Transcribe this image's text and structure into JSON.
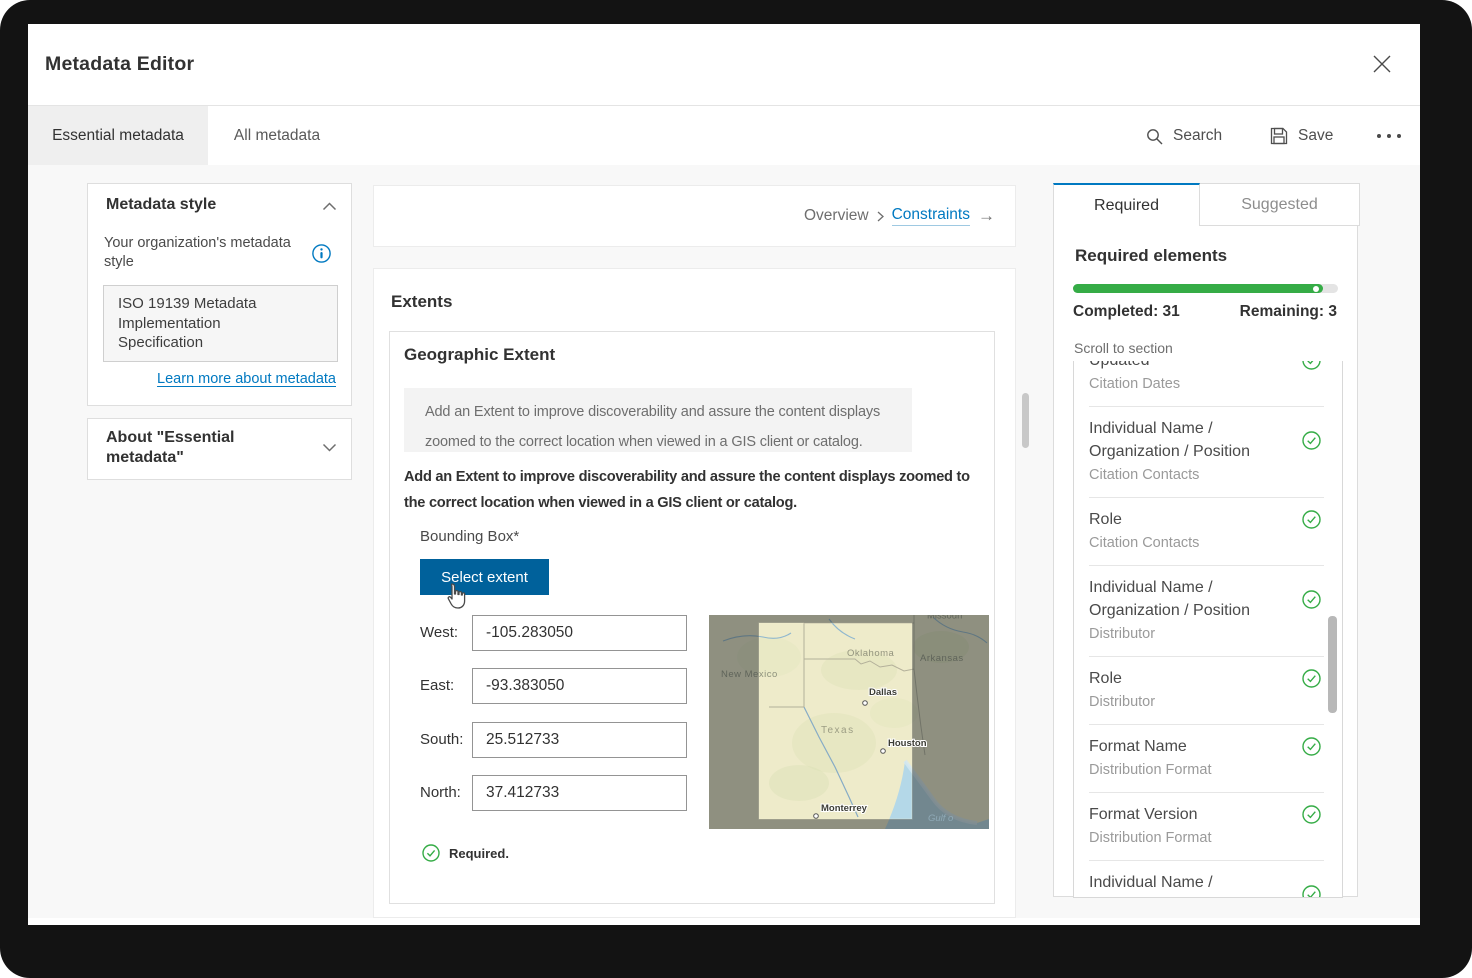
{
  "window": {
    "title": "Metadata Editor"
  },
  "tabs": {
    "essential": "Essential metadata",
    "all": "All metadata",
    "search": "Search",
    "save": "Save"
  },
  "sidebar": {
    "style_panel": {
      "title": "Metadata style",
      "org_label": "Your organization's metadata style",
      "value": "ISO 19139 Metadata Implementation Specification",
      "link": "Learn more about metadata"
    },
    "about_panel": {
      "title": "About \"Essential metadata\""
    }
  },
  "breadcrumb": {
    "previous": "Overview",
    "separator": "›",
    "current": "Constraints",
    "arrow": "→"
  },
  "main": {
    "section_title": "Extents",
    "card_title": "Geographic Extent",
    "info_note": "Add an Extent to improve discoverability and assure the content displays zoomed to the correct location when viewed in a GIS client or catalog.",
    "description": "Add an Extent to improve discoverability and assure the content displays zoomed to the correct location when viewed in a GIS client or catalog.",
    "bounding_box_label": "Bounding Box*",
    "select_extent_button": "Select extent",
    "fields": [
      {
        "label": "West:",
        "value": "-105.283050"
      },
      {
        "label": "East:",
        "value": "-93.383050"
      },
      {
        "label": "South:",
        "value": "25.512733"
      },
      {
        "label": "North:",
        "value": "37.412733"
      }
    ],
    "required_note": "Required.",
    "map": {
      "states": {
        "missouri": "Missouri",
        "oklahoma": "Oklahoma",
        "arkansas": "Arkansas",
        "new_mexico": "New Mexico",
        "texas": "Texas"
      },
      "cities": {
        "dallas": "Dallas",
        "houston": "Houston",
        "monterrey": "Monterrey"
      },
      "water": "Gulf o"
    }
  },
  "panel": {
    "tab_required": "Required",
    "tab_suggested": "Suggested",
    "heading": "Required elements",
    "completed_label": "Completed: 31",
    "remaining_label": "Remaining: 3",
    "completed": 31,
    "remaining": 3,
    "scroll_label": "Scroll to section",
    "items": [
      {
        "title": "Updated",
        "subtitle": "Citation Dates"
      },
      {
        "title": "Individual Name / Organization / Position",
        "subtitle": "Citation Contacts"
      },
      {
        "title": "Role",
        "subtitle": "Citation Contacts"
      },
      {
        "title": "Individual Name / Organization / Position",
        "subtitle": "Distributor"
      },
      {
        "title": "Role",
        "subtitle": "Distributor"
      },
      {
        "title": "Format Name",
        "subtitle": "Distribution Format"
      },
      {
        "title": "Format Version",
        "subtitle": "Distribution Format"
      },
      {
        "title": "Individual Name / Organization / Position",
        "subtitle": ""
      }
    ]
  },
  "colors": {
    "accent": "#0079c1",
    "button": "#00619b",
    "green": "#35ac46"
  }
}
